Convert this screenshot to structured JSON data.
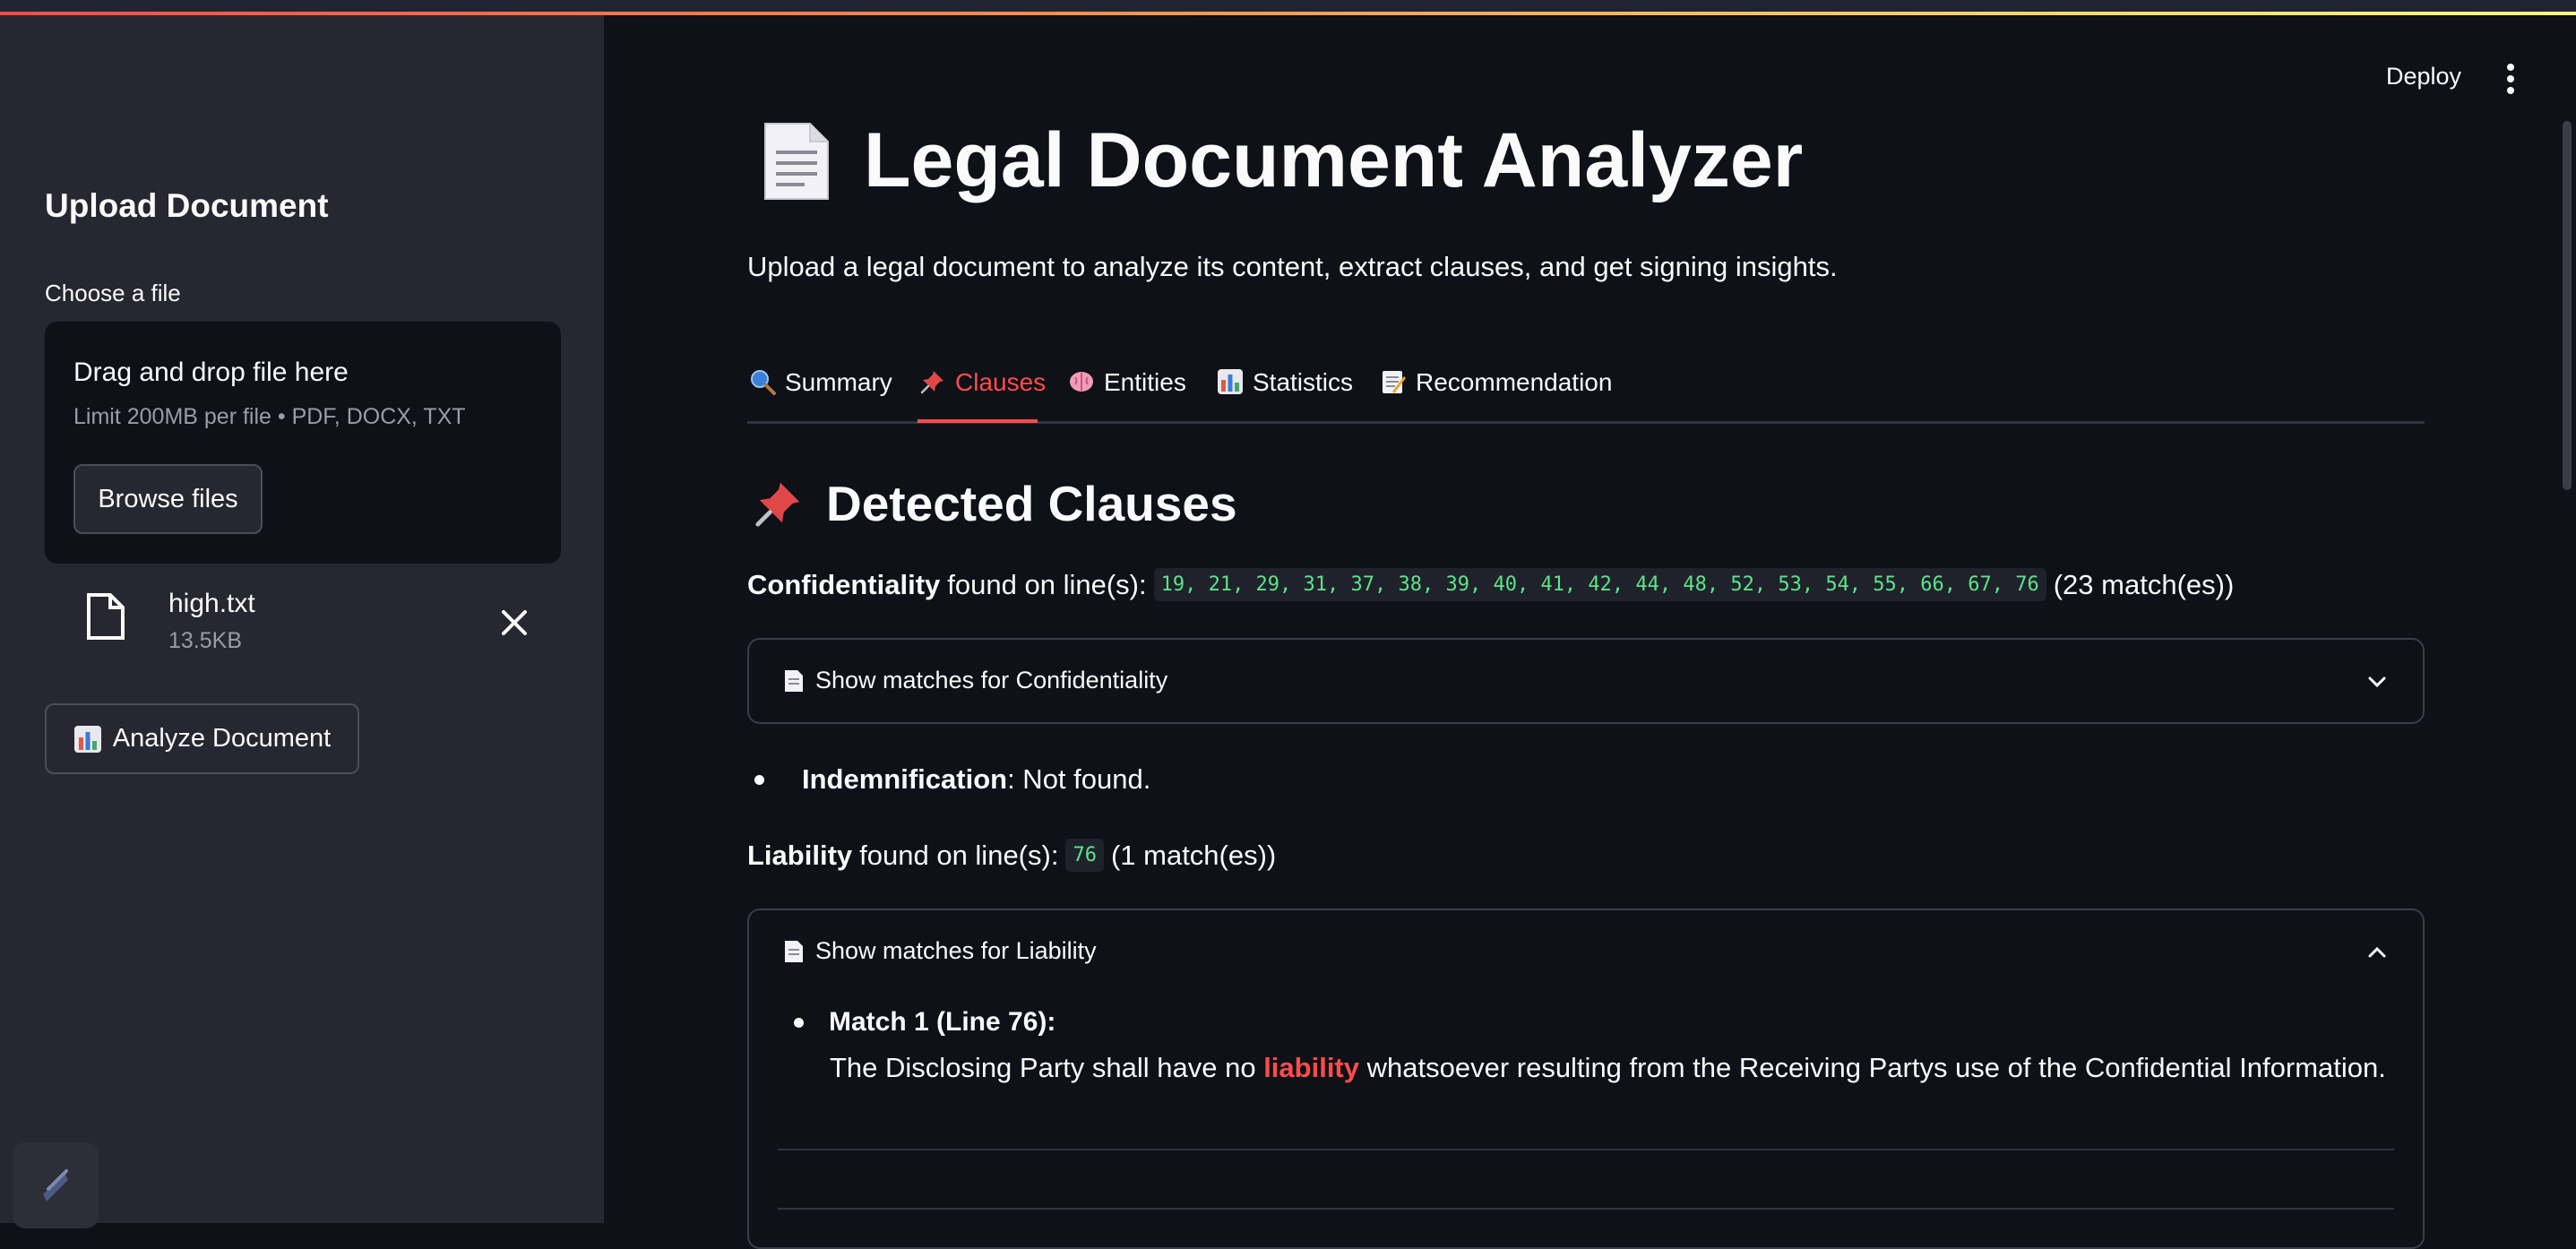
{
  "sidebar": {
    "title": "Upload Document",
    "choose_label": "Choose a file",
    "dropzone": {
      "main": "Drag and drop file here",
      "limit": "Limit 200MB per file • PDF, DOCX, TXT",
      "browse_label": "Browse files"
    },
    "file": {
      "name": "high.txt",
      "size": "13.5KB"
    },
    "analyze_label": "Analyze Document"
  },
  "header": {
    "deploy_label": "Deploy"
  },
  "main": {
    "title": "Legal Document Analyzer",
    "subtitle": "Upload a legal document to analyze its content, extract clauses, and get signing insights.",
    "tabs": [
      {
        "label": "Summary",
        "icon": "magnifier-icon"
      },
      {
        "label": "Clauses",
        "icon": "pushpin-icon"
      },
      {
        "label": "Entities",
        "icon": "brain-icon"
      },
      {
        "label": "Statistics",
        "icon": "bar-chart-icon"
      },
      {
        "label": "Recommendation",
        "icon": "memo-icon"
      }
    ],
    "active_tab": "Clauses",
    "section_title": "Detected Clauses",
    "confidentiality": {
      "name": "Confidentiality",
      "found_text": "found on line(s):",
      "lines": "19, 21, 29, 31, 37, 38, 39, 40, 41, 42, 44, 48, 52, 53, 54, 55, 66, 67, 76",
      "count": "(23 match(es))",
      "expander_label": "Show matches for Confidentiality"
    },
    "indemnification": {
      "name": "Indemnification",
      "status": ": Not found."
    },
    "liability": {
      "name": "Liability",
      "found_text": "found on line(s):",
      "lines": "76",
      "count": "(1 match(es))",
      "expander_label": "Show matches for Liability",
      "match_title": "Match 1 (Line 76):",
      "match_before": "The Disclosing Party shall have no ",
      "match_highlight": "liability",
      "match_after": " whatsoever resulting from the Receiving Partys use of the Confidential Information."
    }
  },
  "colors": {
    "accent": "#ff4b4b",
    "code": "#5ce488",
    "background": "#0e1117",
    "sidebar": "#262730"
  }
}
